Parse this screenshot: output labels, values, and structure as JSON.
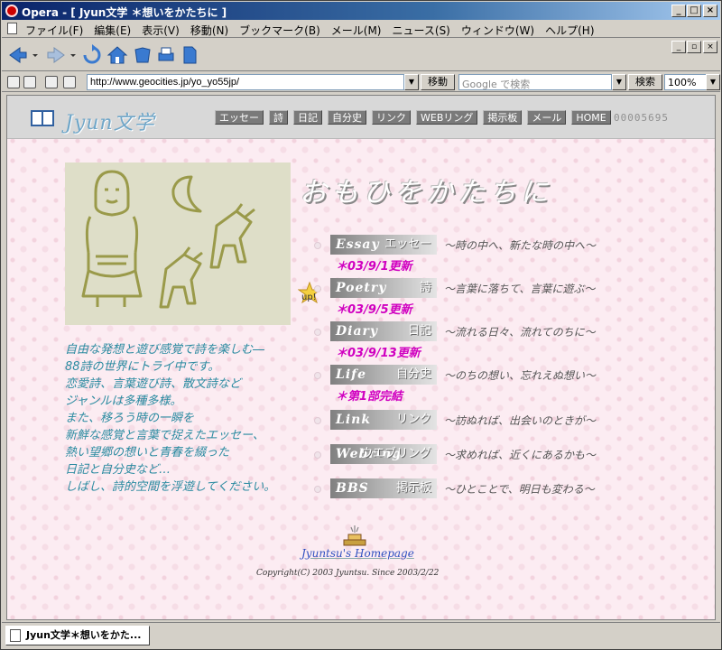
{
  "window": {
    "title": "Opera - [ Jyun文学 ＊想いをかたちに ]"
  },
  "menubar": {
    "items": [
      "ファイル(F)",
      "編集(E)",
      "表示(V)",
      "移動(N)",
      "ブックマーク(B)",
      "メール(M)",
      "ニュース(S)",
      "ウィンドウ(W)",
      "ヘルプ(H)"
    ]
  },
  "addressbar": {
    "url": "http://www.geocities.jp/yo_yo55jp/",
    "go_label": "移動",
    "search_placeholder": "Google で検索",
    "search_label": "検索",
    "zoom": "100%"
  },
  "site": {
    "logo": "Jyun文学",
    "nav": [
      "エッセー",
      "詩",
      "日記",
      "自分史",
      "リンク",
      "WEBリング",
      "掲示板",
      "メール",
      "HOME"
    ],
    "counter": "00005695",
    "title": "おもひをかたちに",
    "intro": [
      "自由な発想と遊び感覚で詩を楽しむ―",
      "88詩の世界にトライ中です。",
      "恋愛詩、言葉遊び詩、散文詩など",
      "ジャンルは多種多様。",
      "また、移ろう時の一瞬を",
      "新鮮な感覚と言葉で捉えたエッセー、",
      "熱い望郷の想いと青春を綴った",
      "日記と自分史など…",
      "しばし、詩的空間を浮遊してください。"
    ],
    "toc": [
      {
        "en": "Essay",
        "ja": "エッセー",
        "desc": "～時の中へ、新たな時の中へ～",
        "update": "＊03/9/1更新"
      },
      {
        "en": "Poetry",
        "ja": "詩",
        "desc": "～言葉に落ちて、言葉に遊ぶ～",
        "update": "＊03/9/5更新"
      },
      {
        "en": "Diary",
        "ja": "日記",
        "desc": "～流れる日々、流れてのちに～",
        "update": "＊03/9/13更新"
      },
      {
        "en": "Life",
        "ja": "自分史",
        "desc": "～のちの想い、忘れえぬ想い～",
        "update": "＊第1部完結"
      },
      {
        "en": "Link",
        "ja": "リンク",
        "desc": "～訪ぬれば、出会いのときが～",
        "update": ""
      },
      {
        "en": "Webring",
        "ja": "ウエブリング",
        "desc": "～求めれば、近くにあるかも～",
        "update": ""
      },
      {
        "en": "BBS",
        "ja": "掲示板",
        "desc": "～ひとことで、明日も変わる～",
        "update": ""
      }
    ],
    "up_badge": "up!",
    "footer_sig": "Jyuntsu's Homepage",
    "copyright": "Copyright(C) 2003 Jyuntsu. Since 2003/2/22"
  },
  "taskbar": {
    "tab": "Jyun文学＊想いをかた..."
  }
}
